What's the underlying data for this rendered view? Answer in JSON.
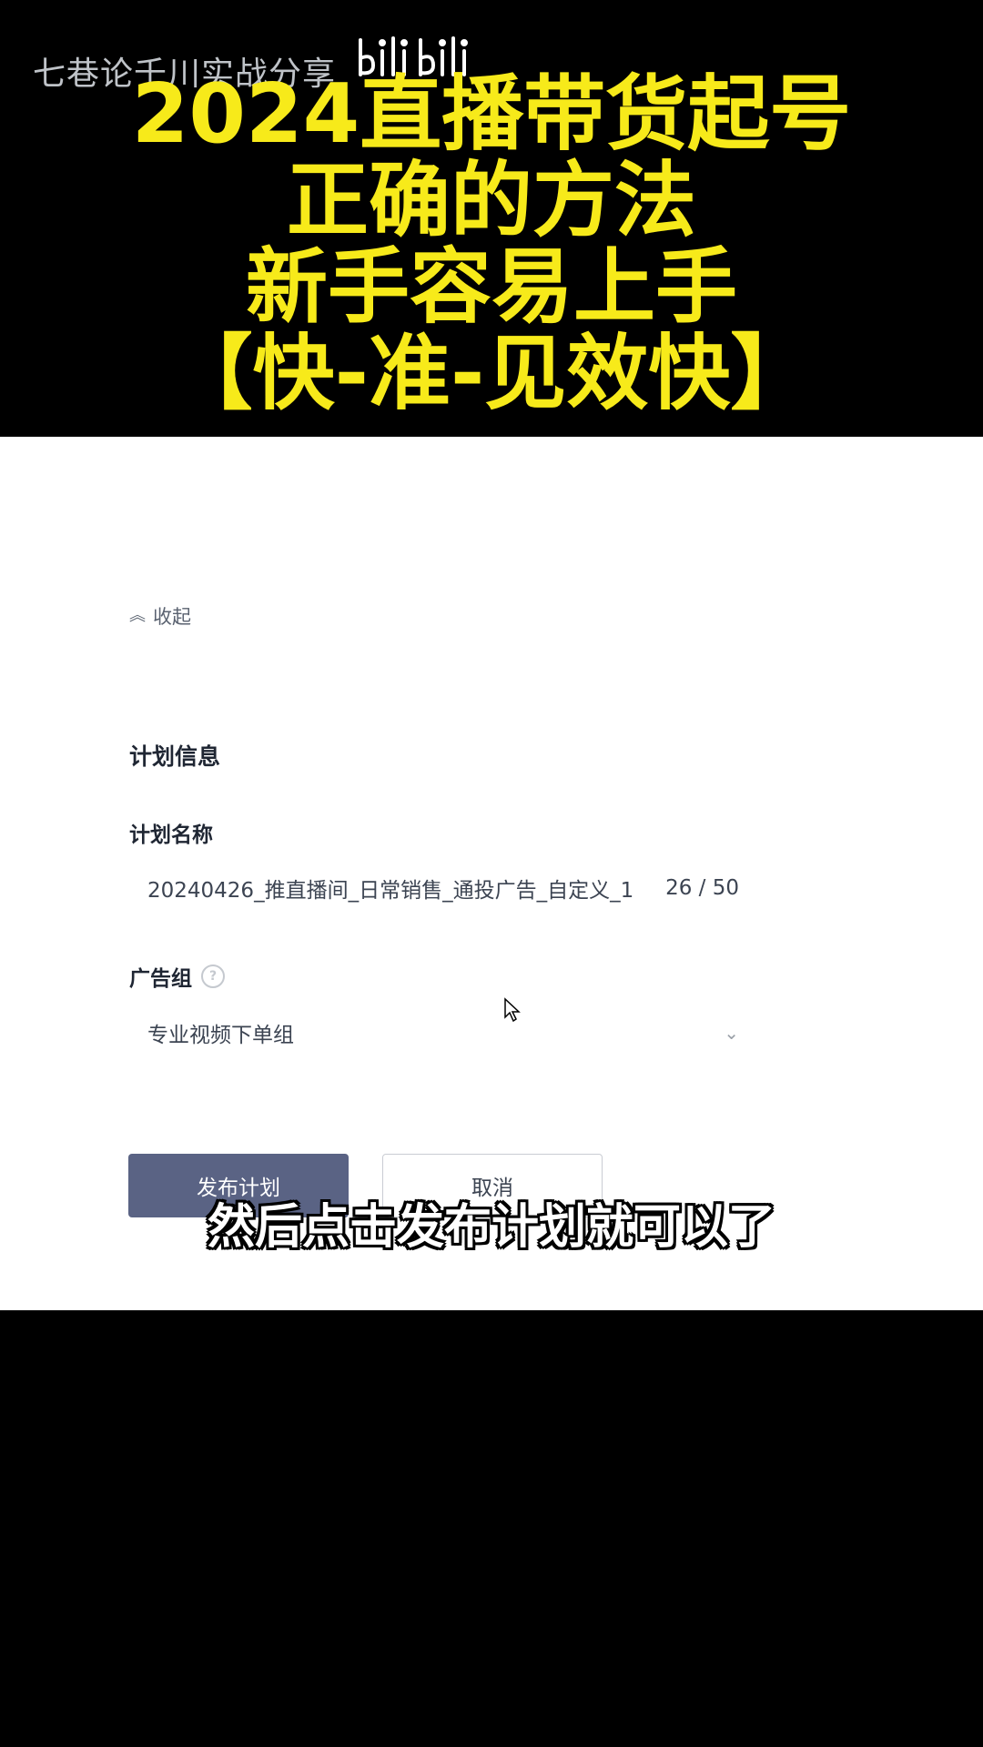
{
  "overlay": {
    "channel_name": "七巷论千川实战分享",
    "title_lines": [
      "2024直播带货起号",
      "正确的方法",
      "新手容易上手",
      "【快-准-见效快】"
    ]
  },
  "form": {
    "collapse_label": "收起",
    "section_title": "计划信息",
    "plan_name": {
      "label": "计划名称",
      "value": "20240426_推直播间_日常销售_通投广告_自定义_1",
      "count": "26 / 50"
    },
    "ad_group": {
      "label": "广告组",
      "value": "专业视频下单组"
    },
    "buttons": {
      "publish": "发布计划",
      "cancel": "取消"
    }
  },
  "subtitle": "然后点击发布计划就可以了",
  "colors": {
    "title_yellow": "#f7ea1a",
    "primary_button": "#5a6384",
    "background": "#000000",
    "panel": "#ffffff"
  }
}
